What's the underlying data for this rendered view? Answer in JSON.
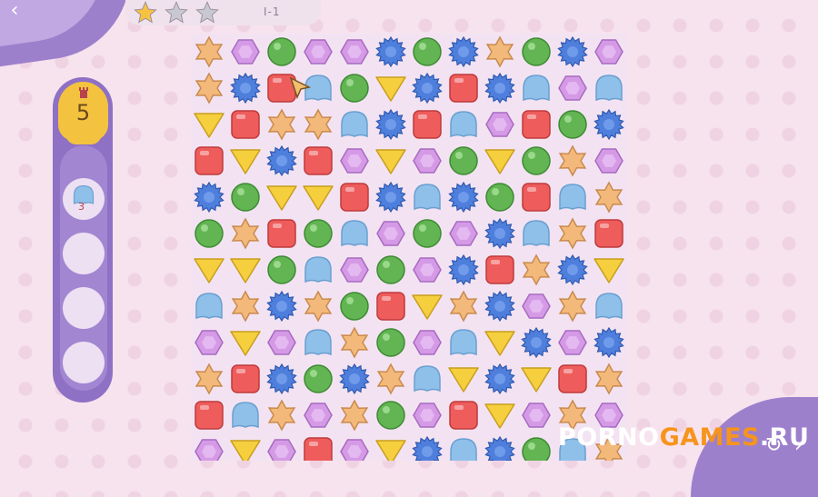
{
  "level": {
    "label": "I-1",
    "stars_earned": 1,
    "stars_total": 3
  },
  "moves": {
    "value": "5"
  },
  "goals": [
    {
      "icon": "blue-jelly-icon",
      "count": "3"
    }
  ],
  "goal_slots_empty": 3,
  "watermark": {
    "part1": "PORNO",
    "part2": "GAMES",
    "part3": ".RU"
  },
  "colors": {
    "accent": "#9d80cc",
    "star_gold": "#f5c242",
    "star_grey": "#c8c8d0",
    "board_bg": "#f3e3f2"
  },
  "board": {
    "rows": 12,
    "cols": 12,
    "grid": [
      [
        "S",
        "P",
        "G",
        "P",
        "P",
        "F",
        "G",
        "F",
        "S",
        "G",
        "F",
        "P"
      ],
      [
        "S",
        "F",
        "R",
        "J",
        "G",
        "T",
        "F",
        "R",
        "F",
        "J",
        "P",
        "J"
      ],
      [
        "T",
        "R",
        "S",
        "S",
        "J",
        "F",
        "R",
        "J",
        "P",
        "R",
        "G",
        "F"
      ],
      [
        "R",
        "T",
        "F",
        "R",
        "P",
        "T",
        "P",
        "G",
        "T",
        "G",
        "S",
        "P"
      ],
      [
        "F",
        "G",
        "T",
        "T",
        "R",
        "F",
        "J",
        "F",
        "G",
        "R",
        "J",
        "S"
      ],
      [
        "G",
        "S",
        "R",
        "G",
        "J",
        "P",
        "G",
        "P",
        "F",
        "J",
        "S",
        "R"
      ],
      [
        "T",
        "T",
        "G",
        "J",
        "P",
        "G",
        "P",
        "F",
        "R",
        "S",
        "F",
        "T"
      ],
      [
        "J",
        "S",
        "F",
        "S",
        "G",
        "R",
        "T",
        "S",
        "F",
        "P",
        "S",
        "J"
      ],
      [
        "P",
        "T",
        "P",
        "J",
        "S",
        "G",
        "P",
        "J",
        "T",
        "F",
        "P",
        "F"
      ],
      [
        "S",
        "R",
        "F",
        "G",
        "F",
        "S",
        "J",
        "T",
        "F",
        "T",
        "R",
        "S"
      ],
      [
        "R",
        "J",
        "S",
        "P",
        "S",
        "G",
        "P",
        "R",
        "T",
        "P",
        "S",
        "P"
      ],
      [
        "P",
        "T",
        "P",
        "R",
        "P",
        "T",
        "F",
        "J",
        "F",
        "G",
        "J",
        "S"
      ]
    ],
    "legend": {
      "S": "orange-star-candy-icon",
      "P": "purple-hexagon-candy-icon",
      "G": "green-round-candy-icon",
      "F": "blue-flower-candy-icon",
      "R": "red-square-candy-icon",
      "J": "blue-jelly-candy-icon",
      "T": "yellow-triangle-candy-icon"
    }
  }
}
